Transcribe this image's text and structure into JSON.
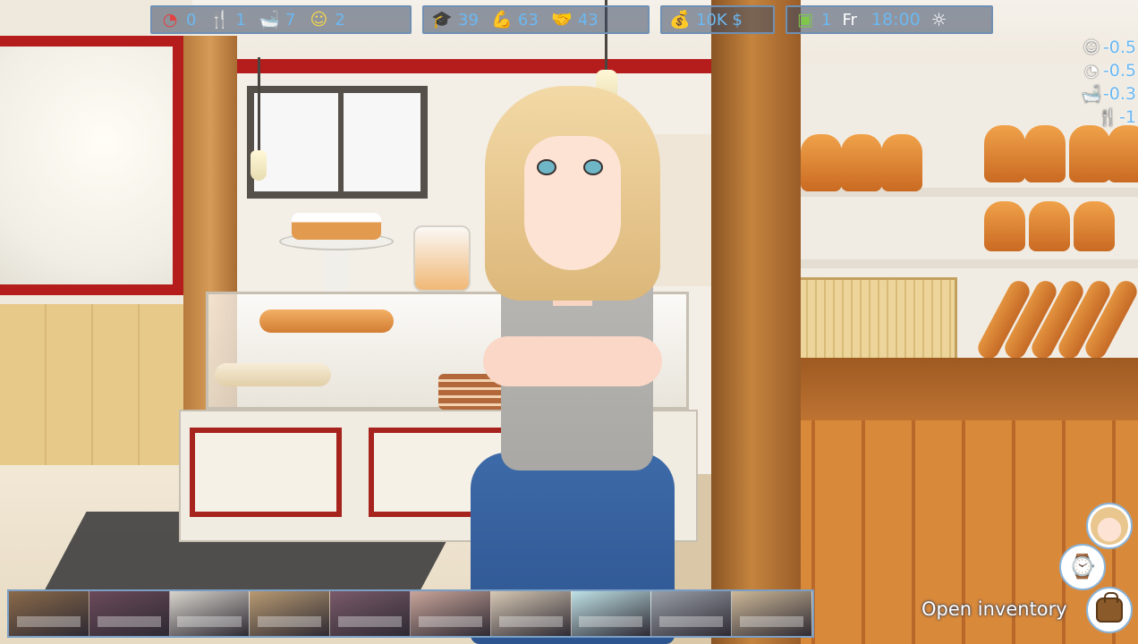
{
  "hud": {
    "needs": [
      {
        "icon": "health-gauge-icon",
        "value": "0"
      },
      {
        "icon": "fork-knife-icon",
        "value": "1"
      },
      {
        "icon": "bathtub-icon",
        "value": "7"
      },
      {
        "icon": "mood-mask-icon",
        "value": "2"
      }
    ],
    "skills": [
      {
        "icon": "graduation-cap-icon",
        "value": "39"
      },
      {
        "icon": "strength-arm-icon",
        "value": "63"
      },
      {
        "icon": "handshake-icon",
        "value": "43"
      }
    ],
    "money": {
      "icon": "money-bag-icon",
      "value": "10K $"
    },
    "time": {
      "icon": "calendar-icon",
      "day_number": "1",
      "weekday": "Fr",
      "clock": "18:00",
      "weather_icon": "sun-icon"
    }
  },
  "effects": [
    {
      "icon": "mood-mask-icon",
      "value": "-0.5"
    },
    {
      "icon": "health-gauge-icon",
      "value": "-0.5"
    },
    {
      "icon": "bathtub-icon",
      "value": "-0.3"
    },
    {
      "icon": "fork-knife-icon",
      "value": "-1"
    }
  ],
  "actions": {
    "inventory_label": "Open inventory"
  },
  "locations": [
    {
      "name": "location-1",
      "color": "#8a6a4a"
    },
    {
      "name": "location-2",
      "color": "#6b4a5a"
    },
    {
      "name": "location-3",
      "color": "#d8d4cc"
    },
    {
      "name": "location-4",
      "color": "#b89a72"
    },
    {
      "name": "location-5",
      "color": "#7a5a6a"
    },
    {
      "name": "location-6",
      "color": "#c9a59a"
    },
    {
      "name": "location-7",
      "color": "#d6c8b4"
    },
    {
      "name": "location-8",
      "color": "#bfe2e6"
    },
    {
      "name": "location-9",
      "color": "#9aa0a8"
    },
    {
      "name": "location-10",
      "color": "#cdb898"
    }
  ]
}
